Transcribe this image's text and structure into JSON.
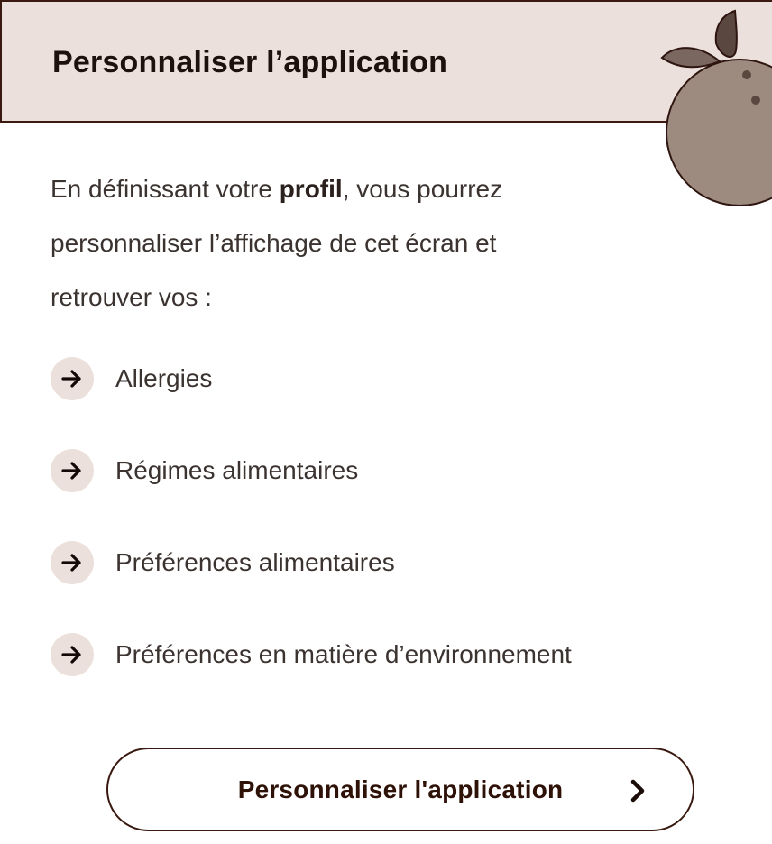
{
  "header": {
    "title": "Personnaliser l’application"
  },
  "intro": {
    "before_bold": "En définissant votre ",
    "bold": "profil",
    "after_bold_line1": ", vous pourrez",
    "line2": "personnaliser l’affichage de cet écran et",
    "line3": "retrouver vos :"
  },
  "list": {
    "items": [
      {
        "label": "Allergies",
        "icon": "arrow-right-icon"
      },
      {
        "label": "Régimes alimentaires",
        "icon": "arrow-right-icon"
      },
      {
        "label": "Préférences alimentaires",
        "icon": "arrow-right-icon"
      },
      {
        "label": "Préférences en matière d’environnement",
        "icon": "arrow-right-icon"
      }
    ]
  },
  "cta": {
    "label": "Personnaliser l'application",
    "icon": "chevron-right-icon"
  },
  "colors": {
    "header_bg": "#ece0dc",
    "border_dark": "#3a1a10",
    "bullet_bg": "#ece0dc",
    "fruit_body": "#9e8b80",
    "fruit_leaf_dark": "#5a4840",
    "fruit_leaf_light": "#7a6860"
  }
}
